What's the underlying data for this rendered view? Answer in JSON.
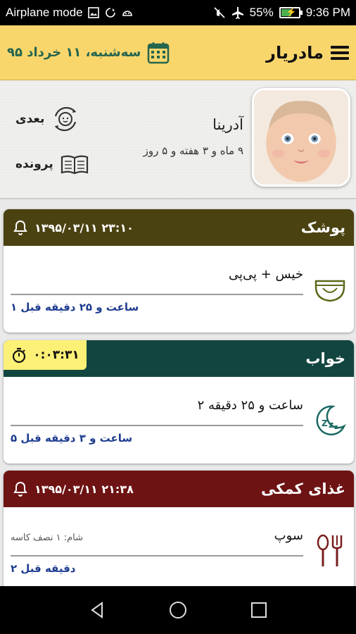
{
  "status_bar": {
    "left_text": "Airplane mode",
    "battery_percent": "55%",
    "battery_level": 0.55,
    "time": "9:36 PM"
  },
  "app_bar": {
    "title": "مادریار",
    "date": "سه‌شنبه، ۱۱ خرداد ۹۵"
  },
  "profile": {
    "name": "آدرینا",
    "age": "۹ ماه و ۳ هفته و ۵ روز",
    "next_label": "بعدی",
    "file_label": "پرونده"
  },
  "cards": [
    {
      "title": "پوشک",
      "meta": "۱۳۹۵/۰۳/۱۱ ۲۳:۱۰",
      "main": "خیس + پی‌پی",
      "note": "",
      "ago": "۱ ساعت و ۲۵ دقیقه قبل",
      "head_color": "#4b4212",
      "icon": "diaper-icon"
    },
    {
      "title": "خواب",
      "timer": "۰:۰۳:۳۱",
      "main": "۲ ساعت و ۲۵ دقیقه",
      "note": "",
      "ago": "۵ ساعت و ۳ دقیقه قبل",
      "head_color": "#124540",
      "icon": "sleep-moon-icon"
    },
    {
      "title": "غذای کمکی",
      "meta": "۱۳۹۵/۰۳/۱۱ ۲۱:۳۸",
      "main": "سوپ",
      "note": "شام: ۱ نصف کاسه",
      "ago": "۲ دقیقه قبل",
      "head_color": "#6d1313",
      "icon": "spoon-fork-icon"
    }
  ],
  "colors": {
    "app_bar": "#f9d66c",
    "date_text": "#24654f",
    "ago_text": "#1e3c8f",
    "timer_chip": "#fdf077"
  }
}
